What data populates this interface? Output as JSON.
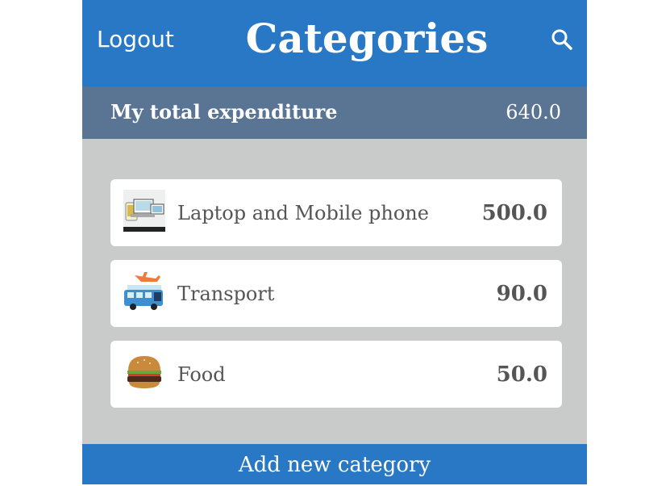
{
  "header": {
    "logout_label": "Logout",
    "title": "Categories",
    "search_icon": "search-icon"
  },
  "summary": {
    "label": "My total expenditure",
    "total": "640.0"
  },
  "categories": [
    {
      "name": "Laptop and Mobile phone",
      "amount": "500.0",
      "icon": "devices-icon"
    },
    {
      "name": "Transport",
      "amount": "90.0",
      "icon": "transport-icon"
    },
    {
      "name": "Food",
      "amount": "50.0",
      "icon": "burger-icon"
    }
  ],
  "footer": {
    "add_label": "Add new category"
  },
  "colors": {
    "header_blue": "#2878c5",
    "summary_bar": "#5a7494",
    "background_gray": "#c8cbca",
    "card_white": "#ffffff"
  }
}
